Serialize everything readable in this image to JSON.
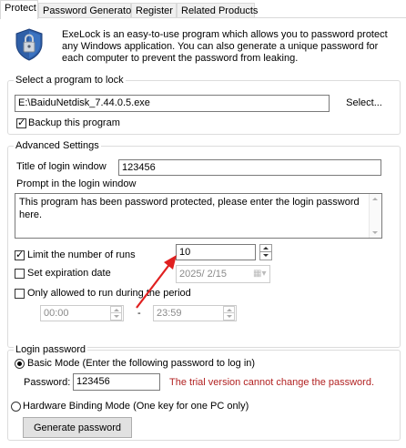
{
  "tabs": [
    "Protect",
    "Password Generator",
    "Register",
    "Related Products"
  ],
  "intro": {
    "description": "ExeLock is an easy-to-use program which allows you to password protect any Windows application. You can also generate a unique password for each computer to prevent the password from leaking."
  },
  "select_program": {
    "legend": "Select a program to lock",
    "path_value": "E:\\BaiduNetdisk_7.44.0.5.exe",
    "select_button": "Select...",
    "backup_label": "Backup this program",
    "backup_checked": true
  },
  "advanced": {
    "legend": "Advanced Settings",
    "title_label": "Title of login window",
    "title_value": "123456",
    "prompt_label": "Prompt in the login window",
    "prompt_value": "This program has been password protected, please enter the login password here.",
    "limit_runs_label": "Limit the number of runs",
    "limit_runs_checked": true,
    "limit_runs_value": "10",
    "expiration_label": "Set expiration date",
    "expiration_checked": false,
    "expiration_value": "2025/ 2/15",
    "period_label": "Only allowed to run during the period",
    "period_checked": false,
    "period_start": "00:00",
    "period_separator": "-",
    "period_end": "23:59"
  },
  "login": {
    "legend": "Login password",
    "basic_mode_label": "Basic Mode (Enter the following password to log in)",
    "password_label": "Password:",
    "password_value": "123456",
    "trial_notice": "The trial version cannot change the password.",
    "hardware_mode_label": "Hardware Binding Mode (One key for one PC only)",
    "generate_button": "Generate password"
  },
  "colors": {
    "notice": "#b22222",
    "arrow": "#e02020",
    "border": "#dcdcdc"
  },
  "icons": {
    "app_icon": "lock-shield-icon",
    "calendar": "calendar-icon"
  }
}
